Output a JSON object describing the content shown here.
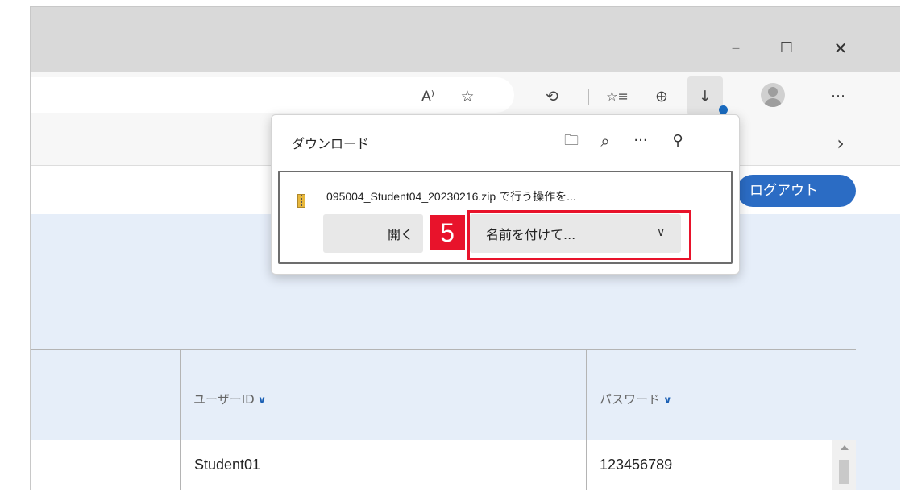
{
  "window": {
    "minimize": "–",
    "maximize": "☐",
    "close": "✕"
  },
  "toolbar": {
    "read_aloud_icon": "A⁾",
    "favorite_add_icon": "☆",
    "extensions_icon": "⟲",
    "favorites_icon": "☆≡",
    "collections_icon": "⊕",
    "downloads_icon": "↓",
    "more_icon": "···"
  },
  "favbar": {
    "chevron": "›"
  },
  "page": {
    "logout_label": "ログアウト"
  },
  "downloads": {
    "title": "ダウンロード",
    "folder_icon": "🗀",
    "search_icon": "⌕",
    "more_icon": "···",
    "pin_icon": "⚲",
    "filename_text": "095004_Student04_20230216.zip で行う操作を...",
    "open_label": "開く",
    "saveas_label": "名前を付けて...",
    "saveas_chevron": "∨"
  },
  "annotation": {
    "step_number": "5",
    "accent_color": "#e8132b"
  },
  "table": {
    "headers": [
      "ユーザーID",
      "パスワード"
    ],
    "sort_icon": "∨",
    "rows": [
      [
        "Student01",
        "123456789"
      ]
    ]
  },
  "colors": {
    "logout_button": "#2b6cc4",
    "content_bg": "#e6eef9",
    "download_badge": "#1a6bbf"
  }
}
